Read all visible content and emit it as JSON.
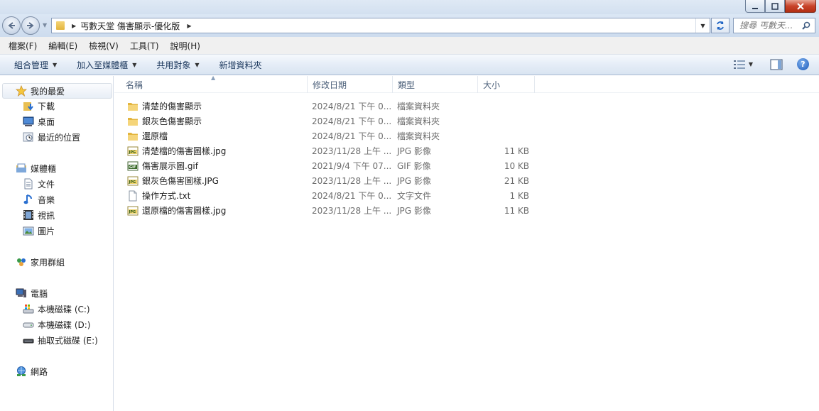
{
  "address": {
    "crumbs": [
      "丐數天堂 傷害顯示-優化版"
    ]
  },
  "search": {
    "placeholder": "搜尋 丐數天..."
  },
  "menu": {
    "items": [
      {
        "label": "檔案(F)"
      },
      {
        "label": "編輯(E)"
      },
      {
        "label": "檢視(V)"
      },
      {
        "label": "工具(T)"
      },
      {
        "label": "說明(H)"
      }
    ]
  },
  "commands": {
    "organize": "組合管理",
    "include_library": "加入至媒體櫃",
    "share": "共用對象",
    "new_folder": "新增資料夾"
  },
  "sidebar": {
    "favorites": {
      "label": "我的最愛",
      "items": [
        {
          "label": "下載",
          "icon": "download-folder-icon"
        },
        {
          "label": "桌面",
          "icon": "desktop-icon"
        },
        {
          "label": "最近的位置",
          "icon": "recent-places-icon"
        }
      ]
    },
    "libraries": {
      "label": "媒體櫃",
      "items": [
        {
          "label": "文件",
          "icon": "documents-icon"
        },
        {
          "label": "音樂",
          "icon": "music-icon"
        },
        {
          "label": "視訊",
          "icon": "video-icon"
        },
        {
          "label": "圖片",
          "icon": "pictures-icon"
        }
      ]
    },
    "homegroup": {
      "label": "家用群組"
    },
    "computer": {
      "label": "電腦",
      "items": [
        {
          "label": "本機磁碟 (C:)",
          "icon": "system-drive-icon"
        },
        {
          "label": "本機磁碟 (D:)",
          "icon": "hard-drive-icon"
        },
        {
          "label": "抽取式磁碟 (E:)",
          "icon": "removable-drive-icon"
        }
      ]
    },
    "network": {
      "label": "網路"
    }
  },
  "columns": {
    "name": "名稱",
    "date": "修改日期",
    "type": "類型",
    "size": "大小"
  },
  "files": [
    {
      "name": "清楚的傷害顯示",
      "date": "2024/8/21 下午 0...",
      "type": "檔案資料夾",
      "size": "",
      "icon": "folder"
    },
    {
      "name": "銀灰色傷害顯示",
      "date": "2024/8/21 下午 0...",
      "type": "檔案資料夾",
      "size": "",
      "icon": "folder"
    },
    {
      "name": "還原檔",
      "date": "2024/8/21 下午 0...",
      "type": "檔案資料夾",
      "size": "",
      "icon": "folder"
    },
    {
      "name": "清楚檔的傷害圖樣.jpg",
      "date": "2023/11/28 上午 ...",
      "type": "JPG 影像",
      "size": "11 KB",
      "icon": "jpg"
    },
    {
      "name": "傷害展示圖.gif",
      "date": "2021/9/4 下午 07...",
      "type": "GIF 影像",
      "size": "10 KB",
      "icon": "gif"
    },
    {
      "name": "銀灰色傷害圖樣.JPG",
      "date": "2023/11/28 上午 ...",
      "type": "JPG 影像",
      "size": "21 KB",
      "icon": "jpg"
    },
    {
      "name": "操作方式.txt",
      "date": "2024/8/21 下午 0...",
      "type": "文字文件",
      "size": "1 KB",
      "icon": "txt"
    },
    {
      "name": "還原檔的傷害圖樣.jpg",
      "date": "2023/11/28 上午 ...",
      "type": "JPG 影像",
      "size": "11 KB",
      "icon": "jpg"
    }
  ]
}
